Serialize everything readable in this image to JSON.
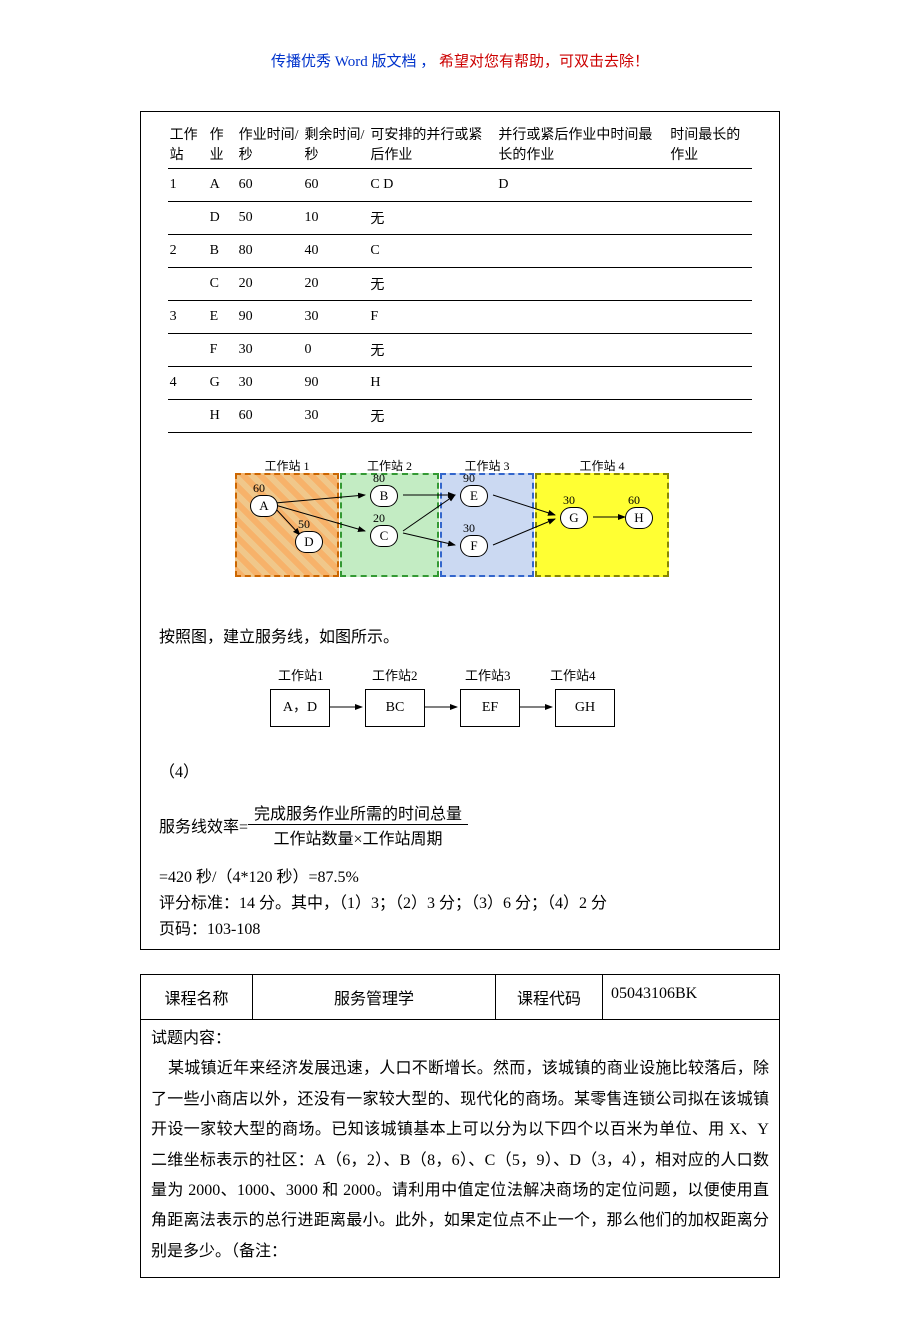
{
  "header_note_part1": "传播优秀 Word 版文档 ，",
  "header_note_part2": "希望对您有帮助，可双击去除！",
  "table1": {
    "headers": [
      "工作站",
      "作业",
      "作业时间/秒",
      "剩余时间/秒",
      "可安排的并行或紧后作业",
      "并行或紧后作业中时间最长的作业",
      "时间最长的作业"
    ],
    "rows": [
      [
        "1",
        "A",
        "60",
        "60",
        "C D",
        "D",
        ""
      ],
      [
        "",
        "D",
        "50",
        "10",
        "无",
        "",
        ""
      ],
      [
        "2",
        "B",
        "80",
        "40",
        "C",
        "",
        ""
      ],
      [
        "",
        "C",
        "20",
        "20",
        "无",
        "",
        ""
      ],
      [
        "3",
        "E",
        "90",
        "30",
        "F",
        "",
        ""
      ],
      [
        "",
        "F",
        "30",
        "0",
        "无",
        "",
        ""
      ],
      [
        "4",
        "G",
        "30",
        "90",
        "H",
        "",
        ""
      ],
      [
        "",
        "H",
        "60",
        "30",
        "无",
        "",
        ""
      ]
    ]
  },
  "diagram1": {
    "ws_labels": [
      "工作站 1",
      "工作站 2",
      "工作站 3",
      "工作站 4"
    ],
    "nodes": {
      "A": {
        "val": "60"
      },
      "D": {
        "val": "50"
      },
      "B": {
        "val": "80"
      },
      "C": {
        "val": "20"
      },
      "E": {
        "val": "90"
      },
      "F": {
        "val": "30"
      },
      "G": {
        "val": "30"
      },
      "H": {
        "val": "60"
      }
    }
  },
  "line_after_diagram": "按照图，建立服务线，如图所示。",
  "flow2": {
    "labels": [
      "工作站1",
      "工作站2",
      "工作站3",
      "工作站4"
    ],
    "boxes": [
      "A，D",
      "BC",
      "EF",
      "GH"
    ]
  },
  "part4_label": "（4）",
  "formula": {
    "lhs": "服务线效率=",
    "num": "完成服务作业所需的时间总量",
    "den": "工作站数量×工作站周期"
  },
  "calc_line": " =420 秒/（4*120 秒）=87.5%",
  "grading_line": "评分标准：14 分。其中，（1）3；（2）3 分；（3）6 分；（4）2 分",
  "page_ref": "页码：103-108",
  "box2": {
    "course_name_label": "课程名称",
    "course_name_value": "服务管理学",
    "course_code_label": "课程代码",
    "course_code_value": "05043106BK",
    "content_label": "试题内容：",
    "paragraph": "某城镇近年来经济发展迅速，人口不断增长。然而，该城镇的商业设施比较落后，除了一些小商店以外，还没有一家较大型的、现代化的商场。某零售连锁公司拟在该城镇开设一家较大型的商场。已知该城镇基本上可以分为以下四个以百米为单位、用 X、Y 二维坐标表示的社区：A（6，2）、B（8，6）、C（5，9）、D（3，4），相对应的人口数量为 2000、1000、3000 和 2000。请利用中值定位法解决商场的定位问题，以便使用直角距离法表示的总行进距离最小。此外，如果定位点不止一个，那么他们的加权距离分别是多少。（备注："
  },
  "chart_data": {
    "type": "table",
    "title": "工作站作业分配表",
    "columns": [
      "工作站",
      "作业",
      "作业时间/秒",
      "剩余时间/秒",
      "可安排的并行或紧后作业",
      "并行或紧后作业中时间最长的作业",
      "时间最长的作业"
    ],
    "data": [
      {
        "工作站": "1",
        "作业": "A",
        "作业时间/秒": 60,
        "剩余时间/秒": 60,
        "可安排的并行或紧后作业": "C D",
        "并行或紧后作业中时间最长的作业": "D",
        "时间最长的作业": ""
      },
      {
        "工作站": "1",
        "作业": "D",
        "作业时间/秒": 50,
        "剩余时间/秒": 10,
        "可安排的并行或紧后作业": "无",
        "并行或紧后作业中时间最长的作业": "",
        "时间最长的作业": ""
      },
      {
        "工作站": "2",
        "作业": "B",
        "作业时间/秒": 80,
        "剩余时间/秒": 40,
        "可安排的并行或紧后作业": "C",
        "并行或紧后作业中时间最长的作业": "",
        "时间最长的作业": ""
      },
      {
        "工作站": "2",
        "作业": "C",
        "作业时间/秒": 20,
        "剩余时间/秒": 20,
        "可安排的并行或紧后作业": "无",
        "并行或紧后作业中时间最长的作业": "",
        "时间最长的作业": ""
      },
      {
        "工作站": "3",
        "作业": "E",
        "作业时间/秒": 90,
        "剩余时间/秒": 30,
        "可安排的并行或紧后作业": "F",
        "并行或紧后作业中时间最长的作业": "",
        "时间最长的作业": ""
      },
      {
        "工作站": "3",
        "作业": "F",
        "作业时间/秒": 30,
        "剩余时间/秒": 0,
        "可安排的并行或紧后作业": "无",
        "并行或紧后作业中时间最长的作业": "",
        "时间最长的作业": ""
      },
      {
        "工作站": "4",
        "作业": "G",
        "作业时间/秒": 30,
        "剩余时间/秒": 90,
        "可安排的并行或紧后作业": "H",
        "并行或紧后作业中时间最长的作业": "",
        "时间最长的作业": ""
      },
      {
        "工作站": "4",
        "作业": "H",
        "作业时间/秒": 60,
        "剩余时间/秒": 30,
        "可安排的并行或紧后作业": "无",
        "并行或紧后作业中时间最长的作业": "",
        "时间最长的作业": ""
      }
    ]
  }
}
